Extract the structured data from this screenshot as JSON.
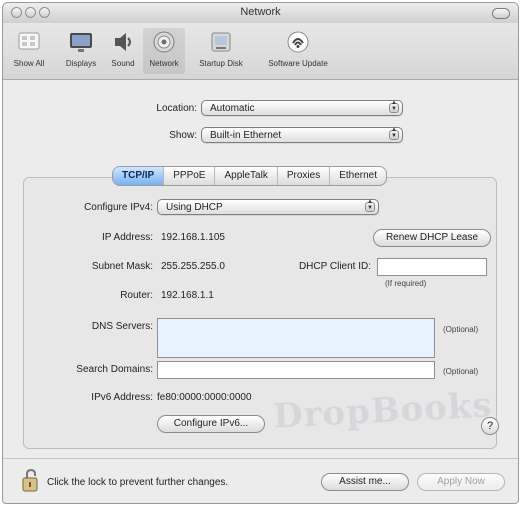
{
  "window": {
    "title": "Network"
  },
  "toolbar": {
    "items": [
      {
        "label": "Show All",
        "icon": "show-all-icon"
      },
      {
        "label": "Displays",
        "icon": "displays-icon"
      },
      {
        "label": "Sound",
        "icon": "sound-icon"
      },
      {
        "label": "Network",
        "icon": "network-icon"
      },
      {
        "label": "Startup Disk",
        "icon": "startup-disk-icon"
      },
      {
        "label": "Software Update",
        "icon": "software-update-icon"
      }
    ]
  },
  "location": {
    "label": "Location:",
    "value": "Automatic"
  },
  "show": {
    "label": "Show:",
    "value": "Built-in Ethernet"
  },
  "tabs": [
    {
      "label": "TCP/IP",
      "selected": true
    },
    {
      "label": "PPPoE",
      "selected": false
    },
    {
      "label": "AppleTalk",
      "selected": false
    },
    {
      "label": "Proxies",
      "selected": false
    },
    {
      "label": "Ethernet",
      "selected": false
    }
  ],
  "tcpip": {
    "configure_label": "Configure IPv4:",
    "configure_value": "Using DHCP",
    "ip_label": "IP Address:",
    "ip_value": "192.168.1.105",
    "renew_button": "Renew DHCP Lease",
    "subnet_label": "Subnet Mask:",
    "subnet_value": "255.255.255.0",
    "dhcp_client_id_label": "DHCP Client ID:",
    "dhcp_client_id_value": "",
    "dhcp_client_id_hint": "(If required)",
    "router_label": "Router:",
    "router_value": "192.168.1.1",
    "dns_label": "DNS Servers:",
    "dns_value": "",
    "dns_optional": "(Optional)",
    "search_label": "Search Domains:",
    "search_value": "",
    "search_optional": "(Optional)",
    "ipv6_label": "IPv6 Address:",
    "ipv6_value": "fe80:0000:0000:0000",
    "configure_ipv6_button": "Configure IPv6...",
    "help_label": "?"
  },
  "footer": {
    "lock_text": "Click the lock to prevent further changes.",
    "assist_button": "Assist me...",
    "apply_button": "Apply Now"
  },
  "watermark": "DropBooks",
  "colors": {
    "selected_tab": "#78b1f2",
    "dns_field_bg": "#e9f2ff"
  }
}
